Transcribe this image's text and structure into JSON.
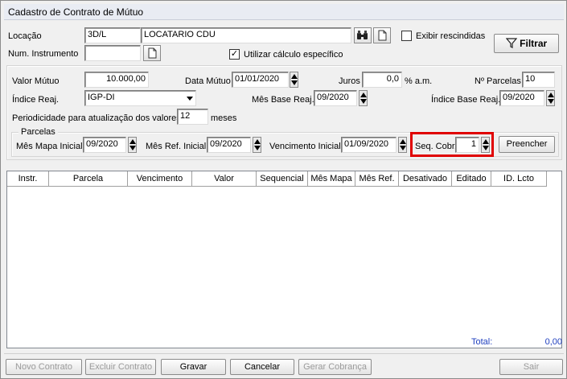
{
  "window": {
    "title": "Cadastro de Contrato de Mútuo"
  },
  "top": {
    "locacao_label": "Locação",
    "locacao_code": "3D/L",
    "locacao_name": "LOCATARIO CDU",
    "exibir_rescindidas_label": "Exibir rescindidas",
    "exibir_rescindidas_checked": "",
    "num_instrumento_label": "Num. Instrumento",
    "num_instrumento_value": "",
    "utilizar_calculo_label": "Utilizar cálculo específico",
    "utilizar_calculo_checked": "✓",
    "filtrar_label": "Filtrar"
  },
  "form": {
    "valor_mutuo_label": "Valor Mútuo",
    "valor_mutuo_value": "10.000,00",
    "data_mutuo_label": "Data Mútuo",
    "data_mutuo_value": "01/01/2020",
    "juros_label": "Juros",
    "juros_value": "0,0",
    "juros_unit": "% a.m.",
    "n_parcelas_label": "Nº Parcelas",
    "n_parcelas_value": "10",
    "indice_reaj_label": "Índice Reaj.",
    "indice_reaj_value": "IGP-DI",
    "mes_base_reaj_label": "Mês Base Reaj.",
    "mes_base_reaj_value": "09/2020",
    "indice_base_reaj_label": "Índice Base Reaj.",
    "indice_base_reaj_value": "09/2020",
    "periodicidade_label": "Periodicidade para atualização dos valores",
    "periodicidade_value": "12",
    "periodicidade_unit": "meses"
  },
  "parcelas": {
    "group_label": "Parcelas",
    "mes_mapa_inicial_label": "Mês Mapa Inicial",
    "mes_mapa_inicial_value": "09/2020",
    "mes_ref_inicial_label": "Mês Ref. Inicial",
    "mes_ref_inicial_value": "09/2020",
    "vencimento_inicial_label": "Vencimento Inicial",
    "vencimento_inicial_value": "01/09/2020",
    "seq_cobr_label": "Seq. Cobr.",
    "seq_cobr_value": "1",
    "preencher_label": "Preencher"
  },
  "grid": {
    "columns": [
      "Instr.",
      "Parcela",
      "Vencimento",
      "Valor",
      "Sequencial",
      "Mês Mapa",
      "Mês Ref.",
      "Desativado",
      "Editado",
      "ID. Lcto"
    ],
    "rows": []
  },
  "footer": {
    "total_label": "Total:",
    "total_value": "0,00"
  },
  "buttons": {
    "novo_contrato": "Novo Contrato",
    "excluir_contrato": "Excluir Contrato",
    "gravar": "Gravar",
    "cancelar": "Cancelar",
    "gerar_cobranca": "Gerar Cobrança",
    "sair": "Sair"
  },
  "colors": {
    "highlight": "#e00000",
    "total": "#1f3fbf"
  }
}
